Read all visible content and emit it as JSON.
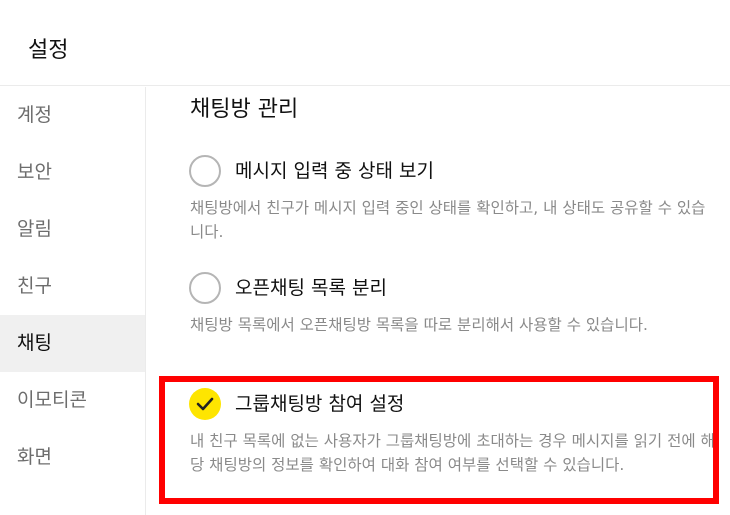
{
  "header": {
    "title": "설정"
  },
  "sidebar": {
    "items": [
      {
        "label": "계정"
      },
      {
        "label": "보안"
      },
      {
        "label": "알림"
      },
      {
        "label": "친구"
      },
      {
        "label": "채팅"
      },
      {
        "label": "이모티콘"
      },
      {
        "label": "화면"
      }
    ],
    "active": "채팅"
  },
  "content": {
    "section_title": "채팅방 관리",
    "options": [
      {
        "label": "메시지 입력 중 상태 보기",
        "description": "채팅방에서 친구가 메시지 입력 중인 상태를 확인하고, 내 상태도 공유할 수 있습니다.",
        "checked": false
      },
      {
        "label": "오픈채팅 목록 분리",
        "description": "채팅방 목록에서 오픈채팅방 목록을 따로 분리해서 사용할 수 있습니다.",
        "checked": false
      },
      {
        "label": "그룹채팅방 참여 설정",
        "description": "내 친구 목록에 없는 사용자가 그룹채팅방에 초대하는 경우 메시지를 읽기 전에 해당 채팅방의 정보를 확인하여 대화 참여 여부를 선택할 수 있습니다.",
        "checked": true
      }
    ]
  },
  "colors": {
    "accent_check": "#fee500",
    "highlight_box": "#ff0000",
    "active_sidebar_bg": "#f0f0f0"
  }
}
